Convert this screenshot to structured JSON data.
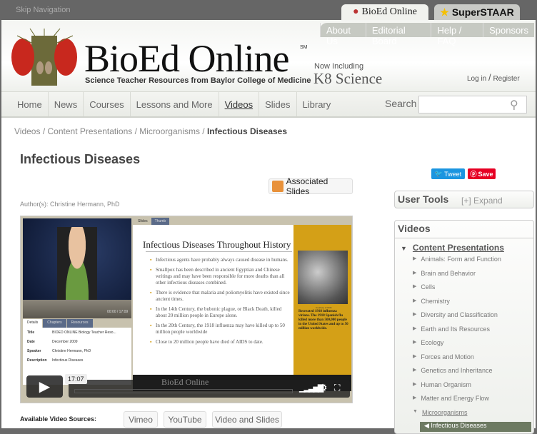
{
  "topbar": {
    "skip": "Skip Navigation",
    "tabs": [
      "BioEd Online",
      "SuperSTAAR"
    ]
  },
  "header": {
    "links": [
      "About Us",
      "Editorial Board",
      "Help / FAQ",
      "Sponsors"
    ],
    "logo": "BioEd Online",
    "sm": "SM",
    "tagline": "Science Teacher Resources from Baylor College of Medicine",
    "now_including": "Now Including",
    "k8": "K8 Science",
    "login": "Log in",
    "sep": "/",
    "register": "Register"
  },
  "nav": {
    "items": [
      "Home",
      "News",
      "Courses",
      "Lessons and More",
      "Videos",
      "Slides",
      "Library"
    ],
    "search_label": "Search",
    "search_value": ""
  },
  "breadcrumb": [
    "Videos",
    "Content Presentations",
    "Microorganisms",
    "Infectious Diseases"
  ],
  "page": {
    "title": "Infectious Diseases",
    "tweet": "Tweet",
    "save": "Save",
    "associated_slides": "Associated Slides",
    "author": "Author(s): Christine Hermann, PhD"
  },
  "player": {
    "timecode": "00:00 / 17:09",
    "detail_tabs": [
      "Details",
      "Chapters",
      "Resources"
    ],
    "details": [
      {
        "k": "Title",
        "v": "BIOED ONLINE Biology Teacher Reso..."
      },
      {
        "k": "Date",
        "v": "December 2009"
      },
      {
        "k": "Speaker",
        "v": "Christine Hermann, PhD"
      },
      {
        "k": "Description",
        "v": "Infectious Diseases"
      }
    ],
    "slide_tabs": [
      "Slides",
      "Thumb"
    ],
    "slide_title": "Infectious Diseases Throughout History",
    "bullets": [
      "Infectious agents have probably always caused disease in humans.",
      "Smallpox has been described in ancient Egyptian and Chinese writings and may have been responsible for more deaths than all other infectious diseases combined.",
      "There is evidence that malaria and poliomyelitis have existed since ancient times.",
      "In the 14th Century, the bubonic plague, or Black Death, killed about 20 million people in Europe alone.",
      "In the 20th Century, the 1918 influenza may have killed up to 50 million people worldwide",
      "Close to 20 million people have died of AIDS to date."
    ],
    "credit": "Courtesy of CDC",
    "caption": "Recreated 1918 influenza virions. The 1918 Spanish flu killed more than 500,000 people in the United States and up to 50 million worldwide.",
    "footer_logo": "BioEd Online",
    "duration": "17:07"
  },
  "sources": {
    "label": "Available Video Sources:",
    "buttons": [
      "Vimeo",
      "YouTube",
      "Video and Slides"
    ]
  },
  "sidebar": {
    "user_tools": "User Tools",
    "expand": "[+] Expand",
    "videos": "Videos",
    "content_presentations": "Content Presentations",
    "items": [
      "Animals: Form and Function",
      "Brain and Behavior",
      "Cells",
      "Chemistry",
      "Diversity and Classification",
      "Earth and Its Resources",
      "Ecology",
      "Forces and Motion",
      "Genetics and Inheritance",
      "Human Organism",
      "Matter and Energy Flow",
      "Microorganisms"
    ],
    "current": "Infectious Diseases"
  }
}
